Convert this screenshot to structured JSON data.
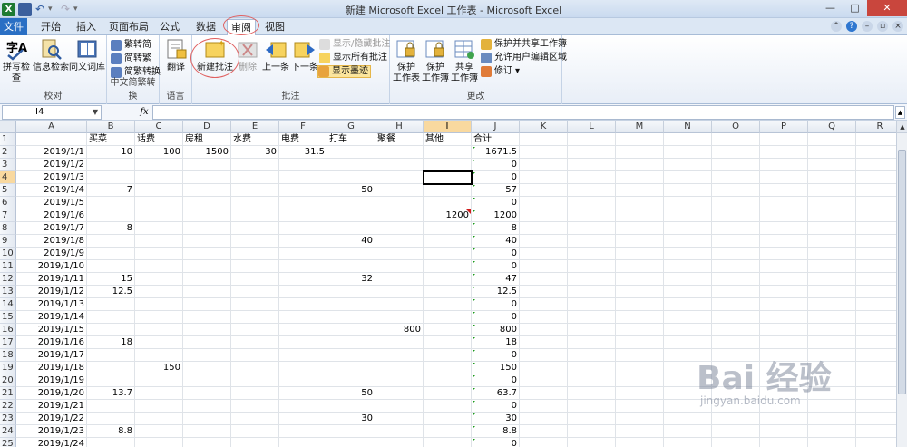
{
  "window": {
    "title": "新建 Microsoft Excel 工作表 - Microsoft Excel",
    "controls": [
      "—",
      "□",
      "✕"
    ]
  },
  "tabs": [
    "文件",
    "开始",
    "插入",
    "页面布局",
    "公式",
    "数据",
    "审阅",
    "视图"
  ],
  "active_tab": "审阅",
  "ribbon": {
    "proofing": {
      "label": "校对",
      "buttons": [
        "拼写检查",
        "信息检索",
        "同义词库"
      ]
    },
    "chinese_conversion": {
      "label": "中文简繁转换",
      "buttons": [
        "繁转简",
        "简转繁",
        "简繁转换"
      ]
    },
    "language": {
      "label": "语言",
      "buttons": [
        "翻译"
      ]
    },
    "comments": {
      "label": "批注",
      "new_comment": "新建批注",
      "delete": "删除",
      "previous": "上一条",
      "next": "下一条",
      "show_hide": "显示/隐藏批注",
      "show_all": "显示所有批注",
      "show_ink": "显示墨迹"
    },
    "changes": {
      "label": "更改",
      "protect_sheet": "保护工作表",
      "protect_workbook": "保护工作簿",
      "share_workbook": "共享工作簿",
      "protect_share": "保护并共享工作簿",
      "allow_edit_ranges": "允许用户编辑区域",
      "track_changes": "修订"
    }
  },
  "formula_bar": {
    "name_box": "I4",
    "fx": "fx",
    "value": ""
  },
  "sheet": {
    "columns": [
      "A",
      "B",
      "C",
      "D",
      "E",
      "F",
      "G",
      "H",
      "I",
      "J",
      "K",
      "L",
      "M",
      "N",
      "O",
      "P",
      "Q",
      "R"
    ],
    "selected_cell": "I4",
    "header_row": [
      "",
      "买菜",
      "话费",
      "房租",
      "水费",
      "电费",
      "打车",
      "聚餐",
      "其他",
      "合计"
    ],
    "rows": [
      [
        "2019/1/1",
        "10",
        "100",
        "1500",
        "30",
        "31.5",
        "",
        "",
        "",
        "1671.5"
      ],
      [
        "2019/1/2",
        "",
        "",
        "",
        "",
        "",
        "",
        "",
        "",
        "0"
      ],
      [
        "2019/1/3",
        "",
        "",
        "",
        "",
        "",
        "",
        "",
        "",
        "0"
      ],
      [
        "2019/1/4",
        "7",
        "",
        "",
        "",
        "",
        "50",
        "",
        "",
        "57"
      ],
      [
        "2019/1/5",
        "",
        "",
        "",
        "",
        "",
        "",
        "",
        "",
        "0"
      ],
      [
        "2019/1/6",
        "",
        "",
        "",
        "",
        "",
        "",
        "",
        "1200",
        "1200"
      ],
      [
        "2019/1/7",
        "8",
        "",
        "",
        "",
        "",
        "",
        "",
        "",
        "8"
      ],
      [
        "2019/1/8",
        "",
        "",
        "",
        "",
        "",
        "40",
        "",
        "",
        "40"
      ],
      [
        "2019/1/9",
        "",
        "",
        "",
        "",
        "",
        "",
        "",
        "",
        "0"
      ],
      [
        "2019/1/10",
        "",
        "",
        "",
        "",
        "",
        "",
        "",
        "",
        "0"
      ],
      [
        "2019/1/11",
        "15",
        "",
        "",
        "",
        "",
        "32",
        "",
        "",
        "47"
      ],
      [
        "2019/1/12",
        "12.5",
        "",
        "",
        "",
        "",
        "",
        "",
        "",
        "12.5"
      ],
      [
        "2019/1/13",
        "",
        "",
        "",
        "",
        "",
        "",
        "",
        "",
        "0"
      ],
      [
        "2019/1/14",
        "",
        "",
        "",
        "",
        "",
        "",
        "",
        "",
        "0"
      ],
      [
        "2019/1/15",
        "",
        "",
        "",
        "",
        "",
        "",
        "800",
        "",
        "800"
      ],
      [
        "2019/1/16",
        "18",
        "",
        "",
        "",
        "",
        "",
        "",
        "",
        "18"
      ],
      [
        "2019/1/17",
        "",
        "",
        "",
        "",
        "",
        "",
        "",
        "",
        "0"
      ],
      [
        "2019/1/18",
        "",
        "150",
        "",
        "",
        "",
        "",
        "",
        "",
        "150"
      ],
      [
        "2019/1/19",
        "",
        "",
        "",
        "",
        "",
        "",
        "",
        "",
        "0"
      ],
      [
        "2019/1/20",
        "13.7",
        "",
        "",
        "",
        "",
        "50",
        "",
        "",
        "63.7"
      ],
      [
        "2019/1/21",
        "",
        "",
        "",
        "",
        "",
        "",
        "",
        "",
        "0"
      ],
      [
        "2019/1/22",
        "",
        "",
        "",
        "",
        "",
        "30",
        "",
        "",
        "30"
      ],
      [
        "2019/1/23",
        "8.8",
        "",
        "",
        "",
        "",
        "",
        "",
        "",
        "8.8"
      ],
      [
        "2019/1/24",
        "",
        "",
        "",
        "",
        "",
        "",
        "",
        "",
        "0"
      ],
      [
        "2019/1/25",
        "",
        "",
        "",
        "",
        "",
        "",
        "",
        "",
        "0"
      ]
    ],
    "comment_cell": "I7"
  },
  "watermark": {
    "brand": "Bai 经验",
    "url": "jingyan.baidu.com"
  },
  "colors": {
    "file_tab": "#2a6fc4",
    "selection_header": "#f9d99f",
    "annotation_circle": "#e06060",
    "error_triangle": "#1a9a1a",
    "comment_indicator": "#d01c1c"
  }
}
